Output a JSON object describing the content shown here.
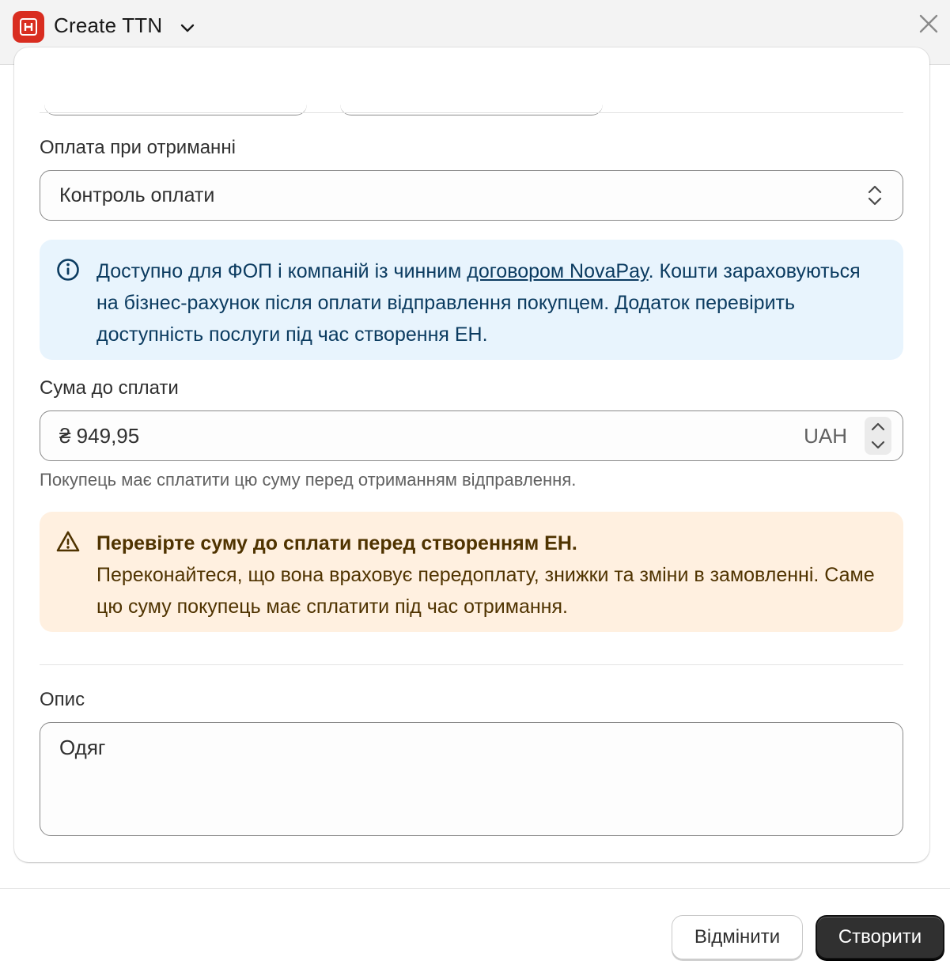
{
  "header": {
    "title": "Create TTN",
    "app_icon": "nova-poshta-app-icon",
    "close_icon": "close-icon"
  },
  "payment_on_delivery": {
    "label": "Оплата при отриманні",
    "selected": "Контроль оплати"
  },
  "info_banner": {
    "text_before": "Доступно для ФОП і компаній із чинним ",
    "link": "договором NovaPay",
    "text_after": ". Кошти зараховуються на бізнес-рахунок після оплати відправлення покупцем. Додаток перевірить доступність послуги під час створення ЕН."
  },
  "amount": {
    "label": "Сума до сплати",
    "value": "₴ 949,95",
    "currency": "UAH",
    "help": "Покупець має сплатити цю суму перед отриманням відправлення."
  },
  "warning_banner": {
    "title": "Перевірте суму до сплати перед створенням ЕН.",
    "body": "Переконайтеся, що вона враховує передоплату, знижки та зміни в замовленні. Саме цю суму покупець має сплатити під час отримання."
  },
  "description": {
    "label": "Опис",
    "value": "Одяг"
  },
  "footer": {
    "cancel_label": "Відмінити",
    "create_label": "Створити"
  },
  "colors": {
    "brand": "#d92d20",
    "info_bg": "#e8f4fd",
    "warning_bg": "#fff0e0",
    "primary_button": "#303030"
  }
}
